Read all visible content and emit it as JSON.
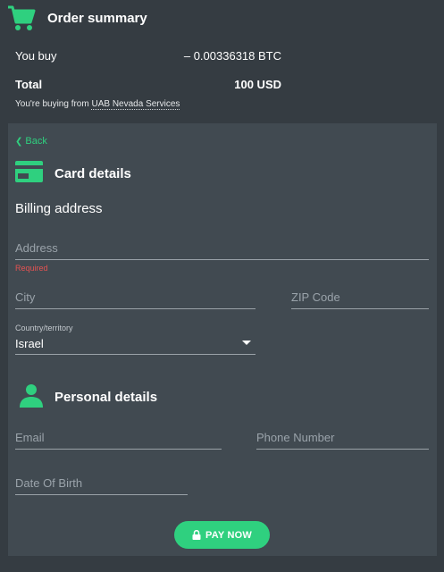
{
  "summary": {
    "title": "Order summary",
    "icon": "cart-icon",
    "you_buy_label": "You buy",
    "you_buy_value": "– 0.00336318 BTC",
    "total_label": "Total",
    "total_value": "100 USD",
    "vendor_prefix": "You're buying from",
    "vendor_name": "UAB Nevada Services"
  },
  "form": {
    "back_label": "Back",
    "card_title": "Card details",
    "billing_title": "Billing address",
    "address_placeholder": "Address",
    "address_error": "Required",
    "city_placeholder": "City",
    "zip_placeholder": "ZIP Code",
    "country_label": "Country/territory",
    "country_value": "Israel",
    "personal_title": "Personal details",
    "email_placeholder": "Email",
    "phone_placeholder": "Phone Number",
    "dob_placeholder": "Date Of Birth",
    "pay_label": "PAY NOW"
  },
  "colors": {
    "background": "#353c42",
    "panel": "#414a51",
    "accent": "#2fd07f",
    "error": "#e45252"
  }
}
